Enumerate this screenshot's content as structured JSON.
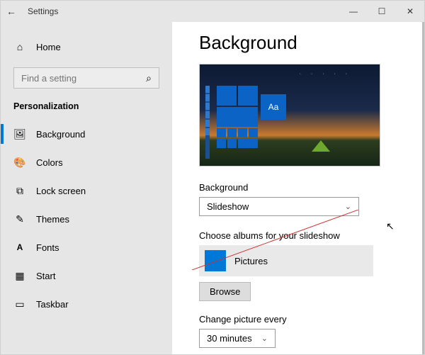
{
  "titlebar": {
    "title": "Settings"
  },
  "sidebar": {
    "home_label": "Home",
    "search_placeholder": "Find a setting",
    "category": "Personalization",
    "items": [
      {
        "label": "Background"
      },
      {
        "label": "Colors"
      },
      {
        "label": "Lock screen"
      },
      {
        "label": "Themes"
      },
      {
        "label": "Fonts"
      },
      {
        "label": "Start"
      },
      {
        "label": "Taskbar"
      }
    ]
  },
  "main": {
    "heading": "Background",
    "preview_aa": "Aa",
    "bg_label": "Background",
    "bg_value": "Slideshow",
    "album_label": "Choose albums for your slideshow",
    "album_value": "Pictures",
    "browse_label": "Browse",
    "change_label": "Change picture every",
    "change_value": "30 minutes"
  }
}
